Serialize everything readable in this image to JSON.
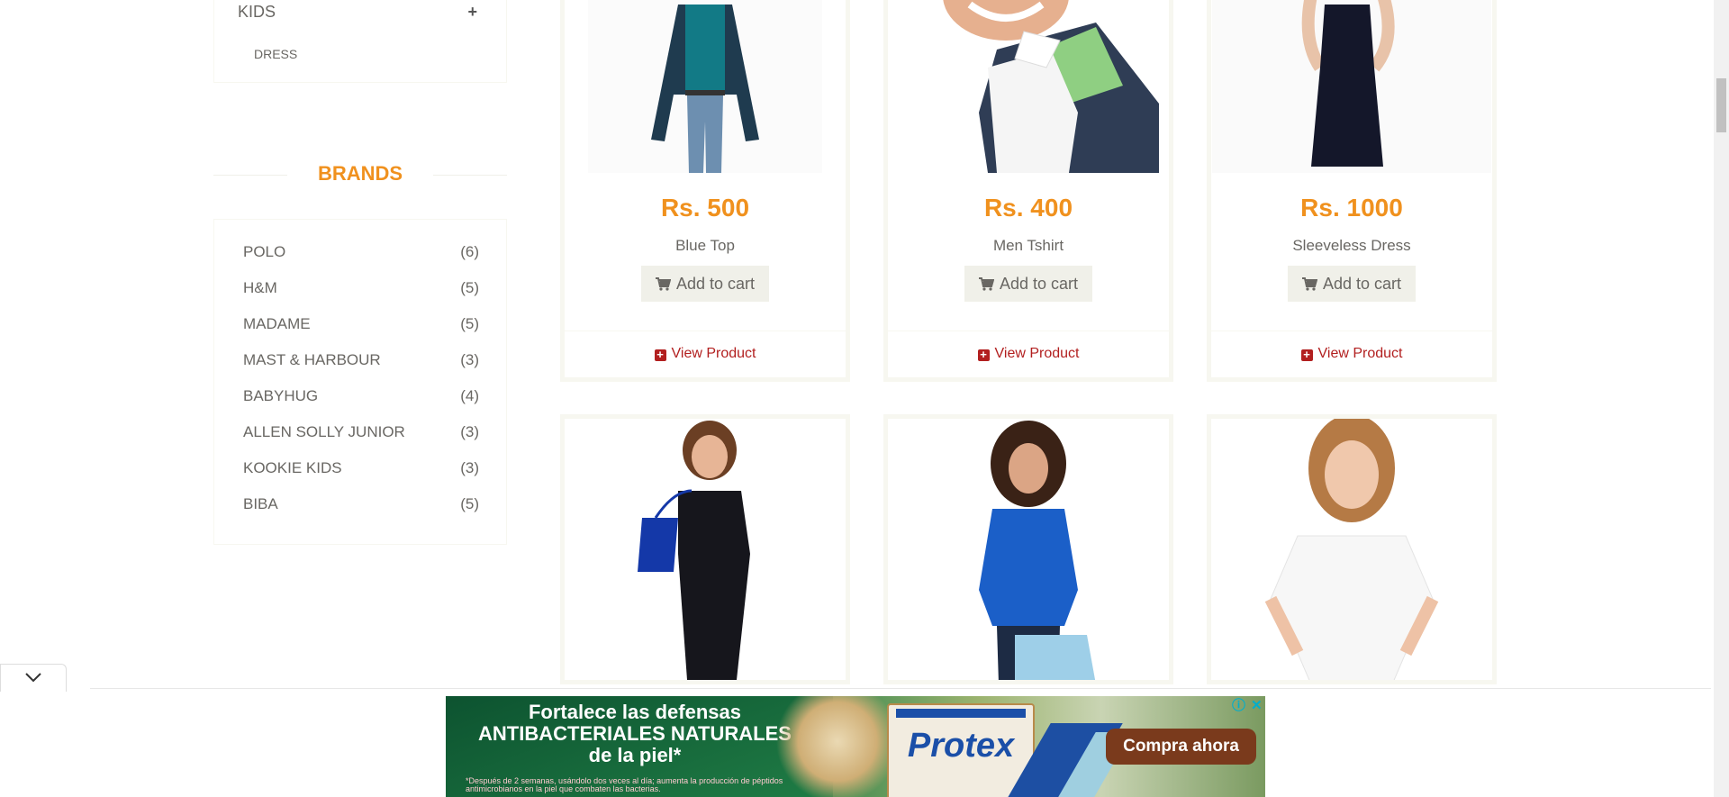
{
  "category": {
    "title": "KIDS",
    "toggle_icon": "+",
    "sub_item": "DRESS"
  },
  "brands": {
    "title": "BRANDS",
    "items": [
      {
        "name": "POLO",
        "count": "(6)"
      },
      {
        "name": "H&M",
        "count": "(5)"
      },
      {
        "name": "MADAME",
        "count": "(5)"
      },
      {
        "name": "MAST & HARBOUR",
        "count": "(3)"
      },
      {
        "name": "BABYHUG",
        "count": "(4)"
      },
      {
        "name": "ALLEN SOLLY JUNIOR",
        "count": "(3)"
      },
      {
        "name": "KOOKIE KIDS",
        "count": "(3)"
      },
      {
        "name": "BIBA",
        "count": "(5)"
      }
    ]
  },
  "products": [
    {
      "price": "Rs. 500",
      "name": "Blue Top",
      "cart_label": "Add to cart",
      "view_label": "View Product"
    },
    {
      "price": "Rs. 400",
      "name": "Men Tshirt",
      "cart_label": "Add to cart",
      "view_label": "View Product"
    },
    {
      "price": "Rs. 1000",
      "name": "Sleeveless Dress",
      "cart_label": "Add to cart",
      "view_label": "View Product"
    }
  ],
  "ad": {
    "headline_1": "Fortalece las defensas",
    "headline_2": "ANTIBACTERIALES NATURALES",
    "headline_3": "de la piel*",
    "fine_print": "*Después de 2 semanas, usándolo dos veces al día; aumenta la producción de péptidos antimicrobianos en la piel que combaten las bacterias.",
    "brand": "Protex",
    "cta": "Compra ahora",
    "info_icon": "ⓘ",
    "close_icon": "✕"
  },
  "colors": {
    "accent": "#f0911e",
    "view_link": "#b21f1f",
    "text": "#696763"
  }
}
